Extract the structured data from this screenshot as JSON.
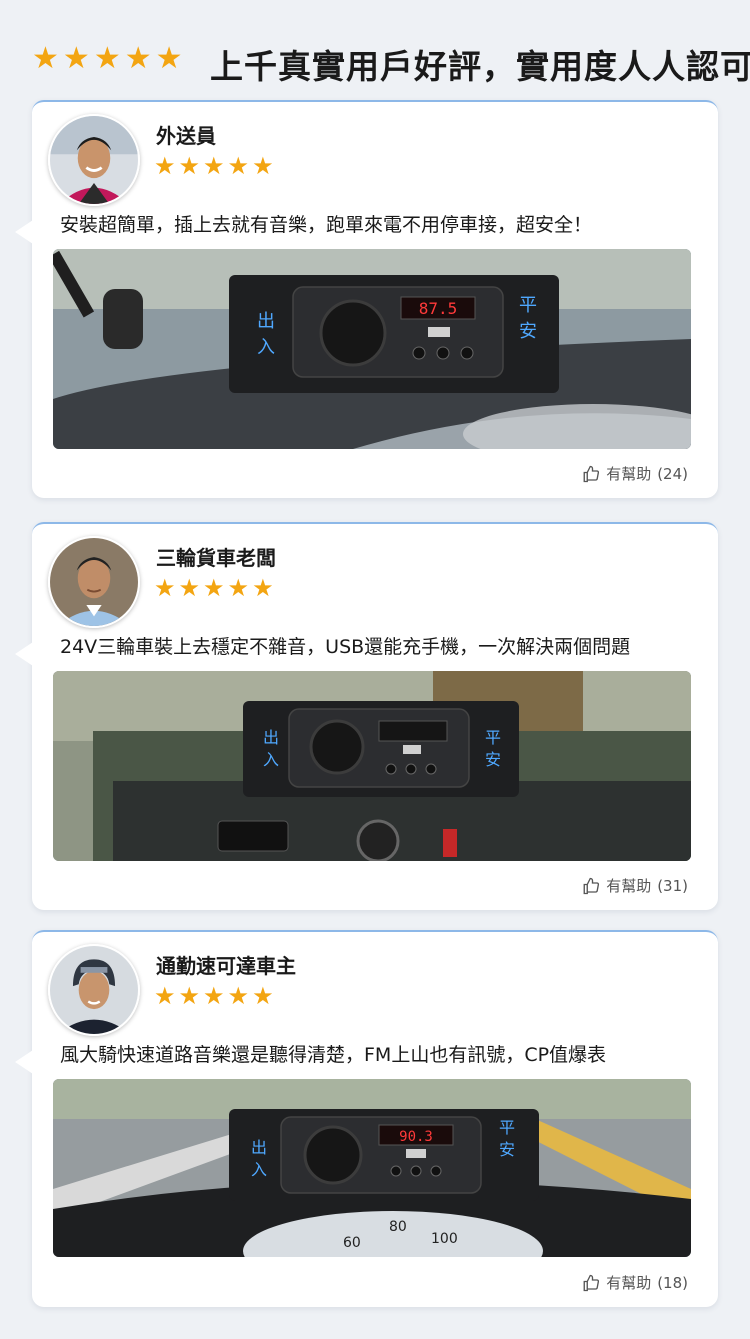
{
  "header": {
    "stars": [
      "★",
      "★",
      "★",
      "★",
      "★"
    ],
    "title": "上千真實用戶好評，實用度人人認可"
  },
  "colors": {
    "star": "#f3a512",
    "accent_border": "#8db8e8",
    "background": "#eef1f5"
  },
  "reviews": [
    {
      "name": "外送員",
      "stars": [
        "★",
        "★",
        "★",
        "★",
        "★"
      ],
      "text": "安裝超簡單，插上去就有音樂，跑單來電不用停車接，超安全！",
      "photo": {
        "left_label": "出\n入",
        "right_label": "平\n安",
        "display": "87.5",
        "usb_label": "USB",
        "vol_minus": "VOL-",
        "vol_plus": "VOL+"
      },
      "helpful_label": "有幫助",
      "helpful_count": "(24)",
      "helpful_icon": "thumbs-up-icon"
    },
    {
      "name": "三輪貨車老闆",
      "stars": [
        "★",
        "★",
        "★",
        "★",
        "★"
      ],
      "text": "24V三輪車裝上去穩定不雜音，USB還能充手機，一次解決兩個問題",
      "photo": {
        "left_label": "出\n入",
        "right_label": "平\n安",
        "display": "",
        "usb_label": "USB",
        "vol_minus": "VOL-",
        "vol_plus": "VOL+"
      },
      "helpful_label": "有幫助",
      "helpful_count": "(31)",
      "helpful_icon": "thumbs-up-icon"
    },
    {
      "name": "通勤速可達車主",
      "stars": [
        "★",
        "★",
        "★",
        "★",
        "★"
      ],
      "text": "風大騎快速道路音樂還是聽得清楚，FM上山也有訊號，CP值爆表",
      "photo": {
        "left_label": "出\n入",
        "right_label": "平\n安",
        "display": "90.3",
        "usb_label": "USB",
        "vol_minus": "VOL-",
        "vol_plus": "VOL+",
        "gauge_60": "60",
        "gauge_80": "80",
        "gauge_100": "100"
      },
      "helpful_label": "有幫助",
      "helpful_count": "(18)",
      "helpful_icon": "thumbs-up-icon"
    }
  ]
}
